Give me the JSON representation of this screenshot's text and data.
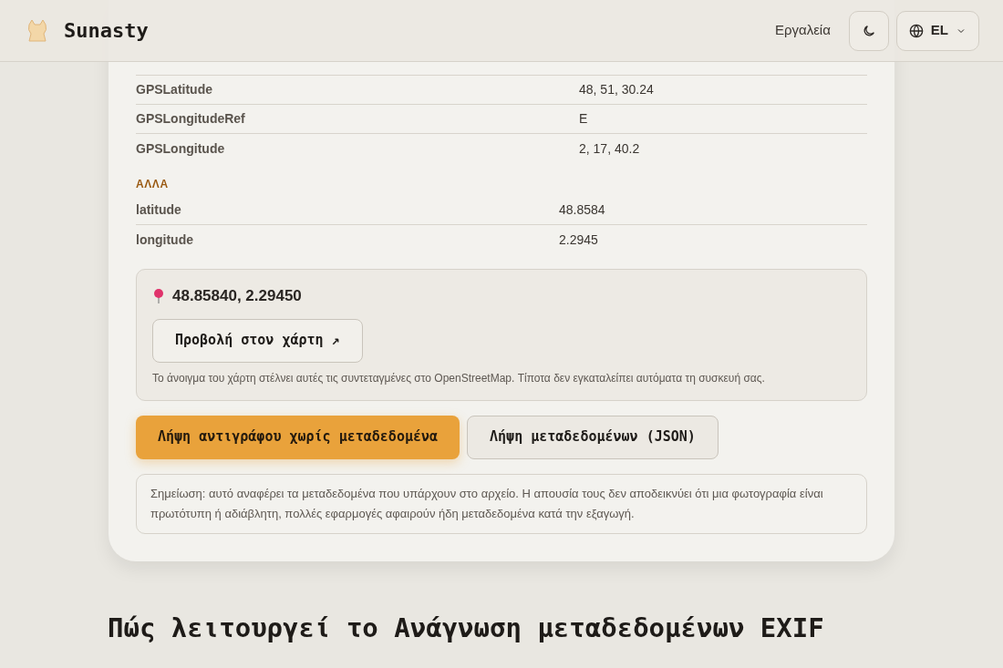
{
  "header": {
    "brand": "Sunasty",
    "nav_link": "Εργαλεία",
    "language": "EL"
  },
  "sections": [
    {
      "rows": [
        {
          "label": "GPSLatitude",
          "value": "48, 51, 30.24"
        },
        {
          "label": "GPSLongitudeRef",
          "value": "E"
        },
        {
          "label": "GPSLongitude",
          "value": "2, 17, 40.2"
        }
      ]
    },
    {
      "title": "ΑΛΛΑ",
      "rows": [
        {
          "label": "latitude",
          "value": "48.8584"
        },
        {
          "label": "longitude",
          "value": "2.2945"
        }
      ]
    }
  ],
  "map": {
    "coordinates": "48.85840, 2.29450",
    "button": "Προβολή στον χάρτη ↗",
    "note": "Το άνοιγμα του χάρτη στέλνει αυτές τις συντεταγμένες στο OpenStreetMap. Τίποτα δεν εγκαταλείπει αυτόματα τη συσκευή σας."
  },
  "actions": [
    {
      "label": "Λήψη αντιγράφου χωρίς μεταδεδομένα",
      "kind": "primary"
    },
    {
      "label": "Λήψη μεταδεδομένων (JSON)",
      "kind": "secondary"
    }
  ],
  "disclaimer": "Σημείωση: αυτό αναφέρει τα μεταδεδομένα που υπάρχουν στο αρχείο. Η απουσία τους δεν αποδεικνύει ότι μια φωτογραφία είναι πρωτότυπη ή αδιάβλητη, πολλές εφαρμογές αφαιρούν ήδη μεταδεδομένα κατά την εξαγωγή.",
  "heading": "Πώς λειτουργεί το Ανάγνωση μεταδεδομένων EXIF"
}
